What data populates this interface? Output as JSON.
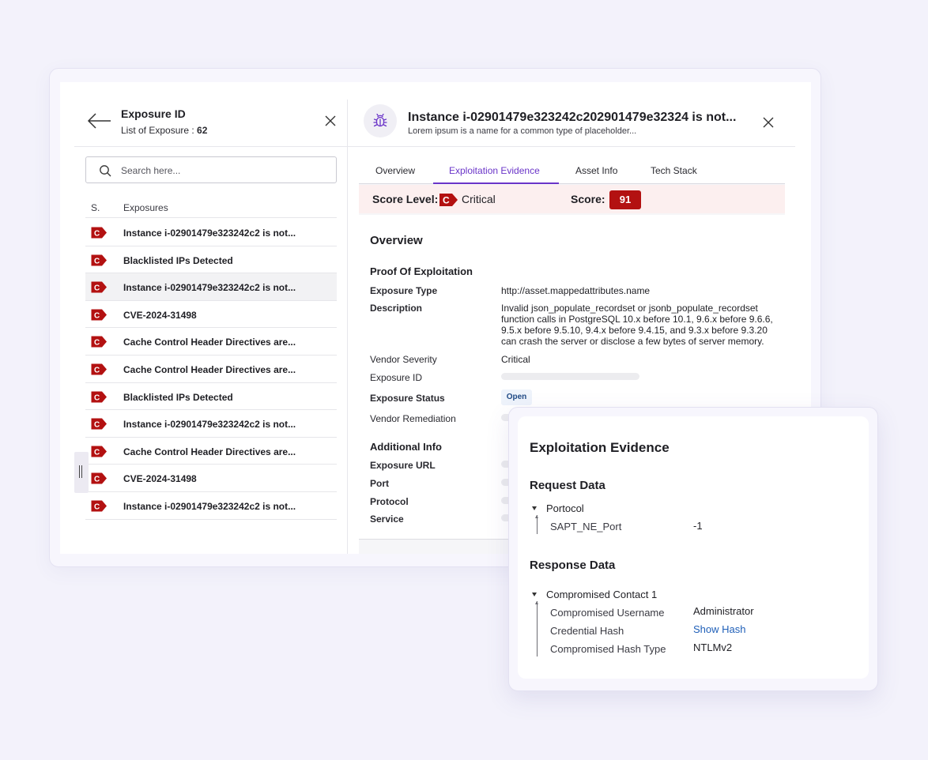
{
  "left_panel": {
    "title": "Exposure ID",
    "subtitle_label": "List of Exposure : ",
    "subtitle_count": "62",
    "search_placeholder": "Search here...",
    "columns": [
      "S.",
      "Exposures"
    ],
    "badge_letter": "C",
    "rows": [
      {
        "label": "Instance i-02901479e323242c2 is not...",
        "selected": false
      },
      {
        "label": "Blacklisted IPs Detected",
        "selected": false
      },
      {
        "label": "Instance i-02901479e323242c2 is not...",
        "selected": true
      },
      {
        "label": "CVE-2024-31498",
        "selected": false
      },
      {
        "label": "Cache Control Header Directives are...",
        "selected": false
      },
      {
        "label": "Cache Control Header Directives are...",
        "selected": false
      },
      {
        "label": "Blacklisted IPs Detected",
        "selected": false
      },
      {
        "label": "Instance i-02901479e323242c2 is not...",
        "selected": false
      },
      {
        "label": "Cache Control Header Directives are...",
        "selected": false
      },
      {
        "label": "CVE-2024-31498",
        "selected": false
      },
      {
        "label": "Instance i-02901479e323242c2 is not...",
        "selected": false
      }
    ]
  },
  "detail": {
    "title": "Instance i-02901479e323242c202901479e32324 is not...",
    "subtitle": "Lorem ipsum is a name for a common type of placeholder...",
    "tabs": [
      "Overview",
      "Exploitation Evidence",
      "Asset Info",
      "Tech Stack"
    ],
    "active_tab": "Exploitation Evidence",
    "score_level_label": "Score Level:",
    "score_level_badge": "C",
    "score_level_value": "Critical",
    "score_label": "Score:",
    "score_value": "91",
    "section_title": "Overview",
    "proof_heading": "Proof Of Exploitation",
    "exposure_type_label": "Exposure Type",
    "exposure_type_value": "http://asset.mappedattributes.name",
    "description_label": "Description",
    "description_value": "Invalid json_populate_recordset or jsonb_populate_recordset function calls in PostgreSQL 10.x before 10.1, 9.6.x before 9.6.6, 9.5.x before 9.5.10, 9.4.x before 9.4.15, and 9.3.x before 9.3.20 can crash the server or disclose a few bytes of server memory.",
    "vendor_severity_label": "Vendor Severity",
    "vendor_severity_value": "Critical",
    "exposure_id_label": "Exposure ID",
    "exposure_status_label": "Exposure Status",
    "exposure_status_value": "Open",
    "vendor_remediation_label": "Vendor Remediation",
    "additional_heading": "Additional Info",
    "exposure_url_label": "Exposure URL",
    "port_label": "Port",
    "protocol_label": "Protocol",
    "service_label": "Service"
  },
  "popup": {
    "title": "Exploitation Evidence",
    "request_heading": "Request Data",
    "request_node": "Portocol",
    "request_key": "SAPT_NE_Port",
    "request_value": "-1",
    "response_heading": "Response Data",
    "response_node": "Compromised Contact 1",
    "fields": [
      {
        "key": "Compromised Username",
        "value": "Administrator"
      },
      {
        "key": "Credential Hash",
        "value": "Show Hash"
      },
      {
        "key": "Compromised Hash Type",
        "value": "NTLMv2"
      }
    ]
  },
  "colors": {
    "accent": "#6a34c8",
    "critical": "#b31111",
    "link": "#1f5fb8",
    "background": "#f3f2fb"
  }
}
